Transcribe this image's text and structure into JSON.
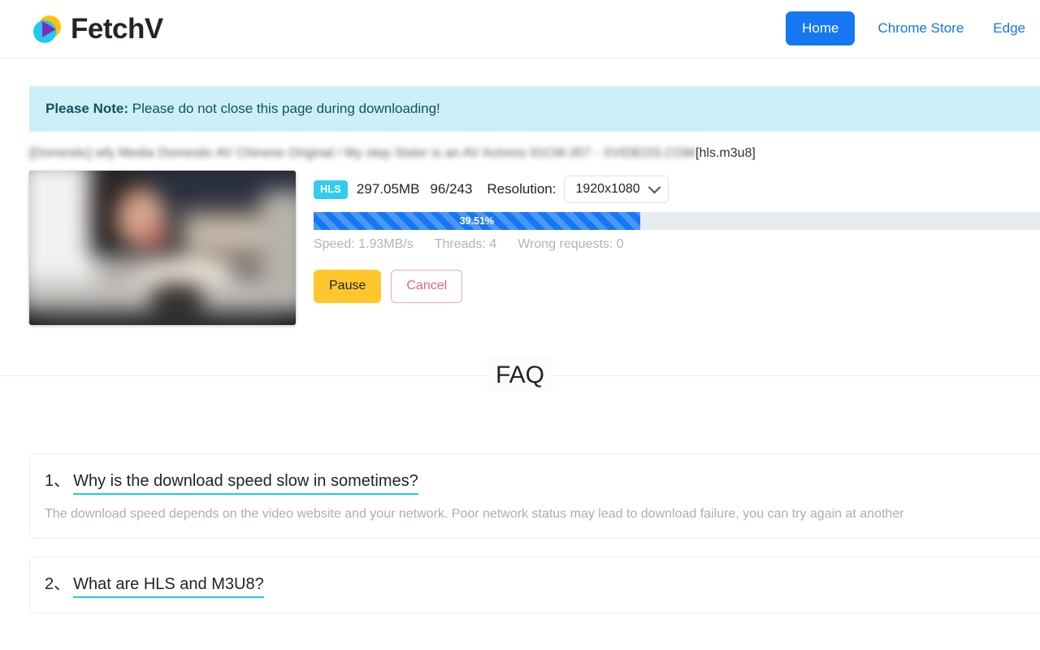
{
  "header": {
    "brand_name": "FetchV",
    "logo_icon": "fetchv-play-logo",
    "nav": [
      {
        "label": "Home",
        "active": true
      },
      {
        "label": "Chrome Store",
        "active": false
      },
      {
        "label": "Edge",
        "active": false
      }
    ]
  },
  "notice": {
    "prefix": "Please Note:",
    "text": " Please do not close this page during downloading!"
  },
  "download": {
    "title_blurred": "[Domestic] wfy Media Domestic AV Chinese Original / My step Sister is an AV Actress 91CM-357 - XVIDEOS.COM",
    "title_extension": "[hls.m3u8]",
    "thumbnail": "blurred-video-thumbnail",
    "format_badge": "HLS",
    "size": "297.05MB",
    "fragments": "96/243",
    "resolution_label": "Resolution:",
    "resolution_value": "1920x1080",
    "resolution_chevron_icon": "chevron-down-icon",
    "progress_percent": "39.51%",
    "progress_value": 39.51,
    "speed": "Speed: 1.93MB/s",
    "threads": "Threads: 4",
    "wrong_requests": "Wrong requests: 0",
    "pause_label": "Pause",
    "cancel_label": "Cancel"
  },
  "faq": {
    "heading": "FAQ",
    "items": [
      {
        "number": "1、",
        "question": "Why is the download speed slow in sometimes?",
        "answer": "The download speed depends on the video website and your network. Poor network status may lead to download failure, you can try again at another"
      },
      {
        "number": "2、",
        "question": "What are HLS and M3U8?",
        "answer": ""
      }
    ]
  },
  "colors": {
    "accent_blue": "#1677f2",
    "link_blue": "#1a73e8",
    "notice_bg": "#cdf0f8",
    "badge_cyan": "#33ccee",
    "pause_yellow": "#ffc72c",
    "cancel_pink": "#e8657f",
    "underline_cyan": "#22c8ee"
  }
}
